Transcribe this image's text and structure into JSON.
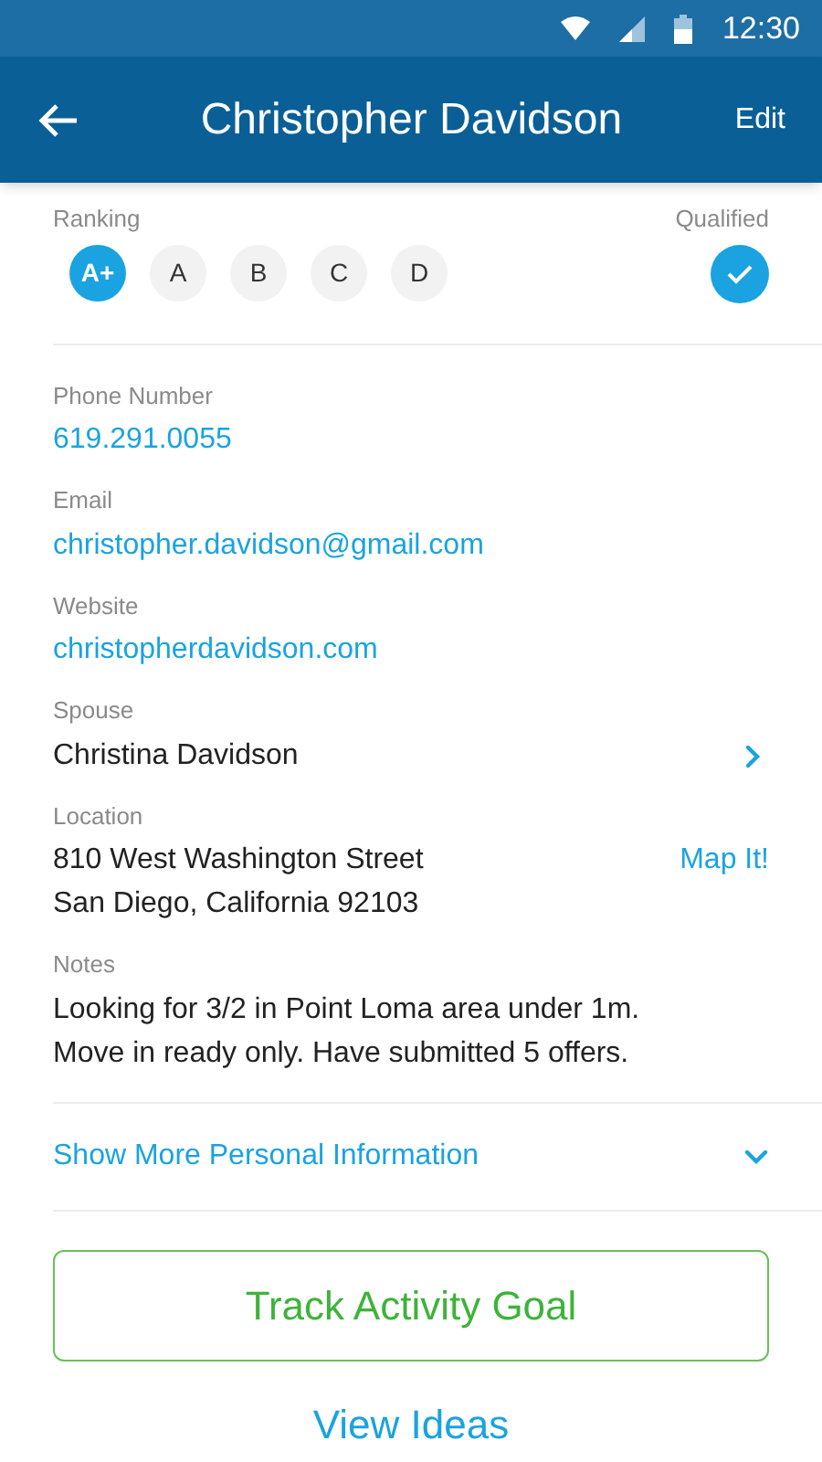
{
  "status_bar": {
    "time": "12:30"
  },
  "header": {
    "title": "Christopher Davidson",
    "action": "Edit"
  },
  "ranking": {
    "label": "Ranking",
    "options": [
      {
        "label": "A+",
        "selected": true
      },
      {
        "label": "A",
        "selected": false
      },
      {
        "label": "B",
        "selected": false
      },
      {
        "label": "C",
        "selected": false
      },
      {
        "label": "D",
        "selected": false
      }
    ]
  },
  "qualified": {
    "label": "Qualified",
    "checked": true
  },
  "fields": [
    {
      "kind": "link",
      "label": "Phone Number",
      "lines": [
        "619.291.0055"
      ]
    },
    {
      "kind": "link",
      "label": "Email",
      "lines": [
        "christopher.davidson@gmail.com"
      ]
    },
    {
      "kind": "link",
      "label": "Website",
      "lines": [
        "christopherdavidson.com"
      ]
    },
    {
      "kind": "nav",
      "label": "Spouse",
      "lines": [
        "Christina Davidson"
      ]
    },
    {
      "kind": "action",
      "label": "Location",
      "lines": [
        "810 West Washington Street",
        "San Diego, California 92103"
      ],
      "action": "Map It!"
    },
    {
      "kind": "text",
      "label": "Notes",
      "lines": [
        "Looking for 3/2 in Point Loma area under 1m.",
        "Move in ready only. Have submitted 5 offers."
      ]
    }
  ],
  "more": {
    "label": "Show More Personal Information",
    "expanded": false
  },
  "primary_button": "Track Activity Goal",
  "secondary_link": "View Ideas"
}
